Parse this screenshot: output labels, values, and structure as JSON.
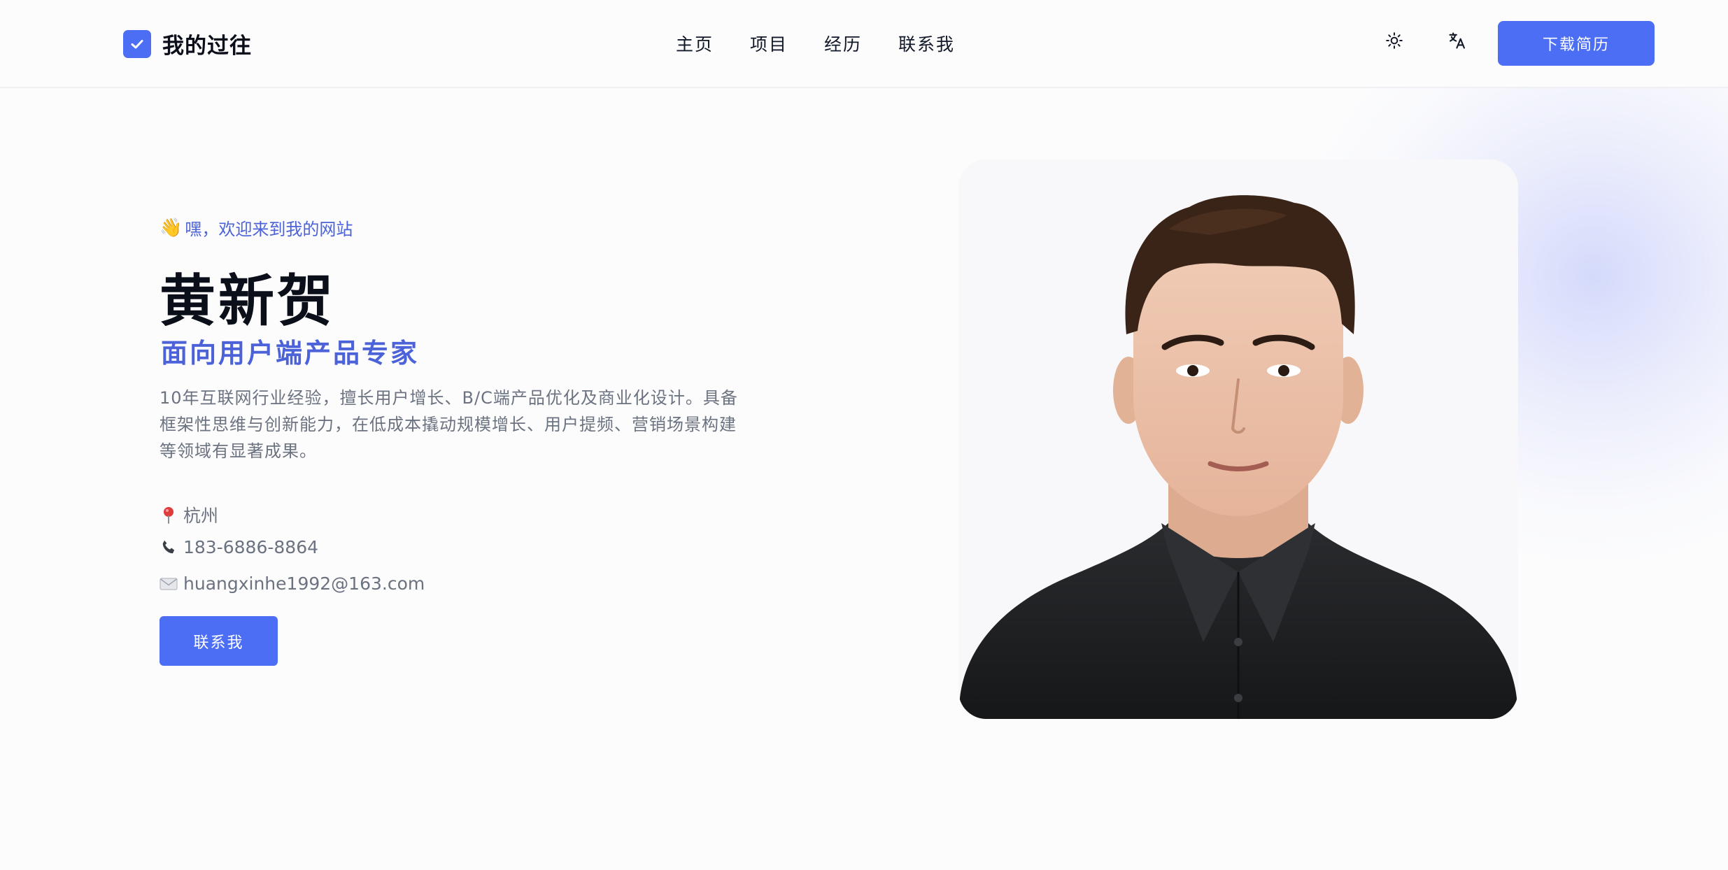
{
  "header": {
    "brand": "我的过往",
    "nav": [
      {
        "label": "主页"
      },
      {
        "label": "项目"
      },
      {
        "label": "经历"
      },
      {
        "label": "联系我"
      }
    ],
    "theme_toggle_icon": "sun-icon",
    "language_icon": "translate-icon",
    "download_button": "下载简历"
  },
  "hero": {
    "greeting_emoji": "👋",
    "greeting": "嘿，欢迎来到我的网站",
    "name": "黄新贺",
    "role": "面向用户端产品专家",
    "bio": "10年互联网行业经验，擅长用户增长、B/C端产品优化及商业化设计。具备框架性思维与创新能力，在低成本撬动规模增长、用户提频、营销场景构建等领域有显著成果。",
    "location": "杭州",
    "phone": "183-6886-8864",
    "email": "huangxinhe1992@163.com",
    "contact_button": "联系我"
  },
  "colors": {
    "accent": "#4c6ef5",
    "accent_text": "#4c62d8",
    "muted_text": "#6b7280"
  }
}
